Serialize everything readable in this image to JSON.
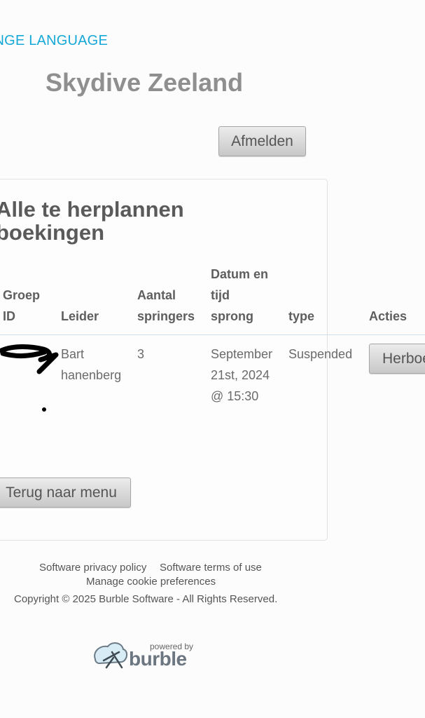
{
  "header": {
    "language_link": "ANGE LANGUAGE",
    "site_title": "Skydive Zeeland",
    "logout_label": "Afmelden"
  },
  "card": {
    "title": "Alle te herplannen boekingen",
    "columns": {
      "group_id": [
        "Groep",
        "ID"
      ],
      "leader": "Leider",
      "jumpers": [
        "Aantal",
        "springers"
      ],
      "datetime": [
        "Datum en",
        "tijd",
        "sprong"
      ],
      "type": "type",
      "actions": "Acties"
    },
    "rows": [
      {
        "leader": [
          "Bart",
          "hanenberg"
        ],
        "jumpers": "3",
        "datetime": [
          "September",
          "21st, 2024",
          "@ 15:30"
        ],
        "type": "Suspended",
        "action_label": "Herboe"
      }
    ],
    "back_label": "Terug naar menu"
  },
  "footer": {
    "privacy": "Software privacy policy",
    "terms": "Software terms of use",
    "cookies": "Manage cookie preferences",
    "copyright": "Copyright © 2025 Burble Software - All Rights Reserved.",
    "powered_by": "powered by",
    "brand": "burble"
  }
}
